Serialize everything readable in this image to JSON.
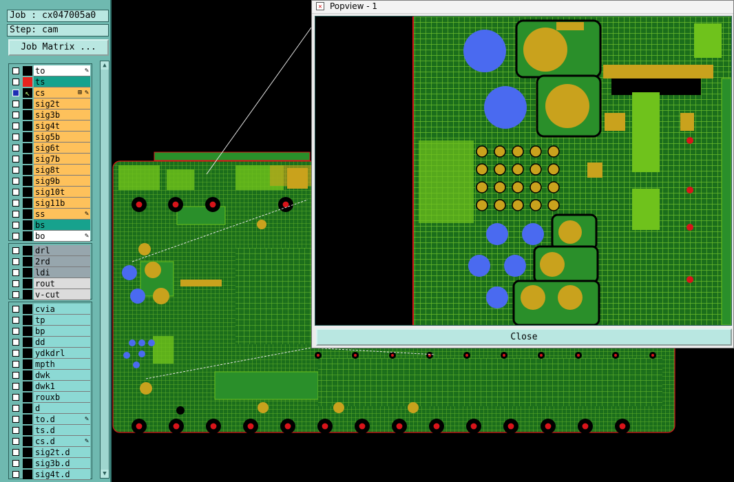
{
  "job_label": "Job : cx047005a0",
  "step_label": "Step: cam",
  "job_matrix_label": "Job Matrix ...",
  "board_layers": [
    {
      "name": "to",
      "color": "#ffffff",
      "mark": "✎"
    },
    {
      "name": "ts",
      "color": "#17a28d",
      "swatch": "red"
    },
    {
      "name": "cs",
      "color": "#fec15b",
      "mark": "✎",
      "mark2": "⊞",
      "checked": true,
      "swatch": "arrow"
    },
    {
      "name": "sig2t",
      "color": "#fec15b"
    },
    {
      "name": "sig3b",
      "color": "#fec15b"
    },
    {
      "name": "sig4t",
      "color": "#fec15b"
    },
    {
      "name": "sig5b",
      "color": "#fec15b"
    },
    {
      "name": "sig6t",
      "color": "#fec15b"
    },
    {
      "name": "sig7b",
      "color": "#fec15b"
    },
    {
      "name": "sig8t",
      "color": "#fec15b"
    },
    {
      "name": "sig9b",
      "color": "#fec15b"
    },
    {
      "name": "sig10t",
      "color": "#fec15b"
    },
    {
      "name": "sig11b",
      "color": "#fec15b"
    },
    {
      "name": "ss",
      "color": "#fec15b",
      "mark": "✎"
    },
    {
      "name": "bs",
      "color": "#17a28d"
    },
    {
      "name": "bo",
      "color": "#ffffff",
      "mark": "✎"
    }
  ],
  "drill_layers": [
    {
      "name": "drl",
      "color": "#97a6ad"
    },
    {
      "name": "2rd",
      "color": "#97a6ad"
    },
    {
      "name": "ldi",
      "color": "#97a6ad"
    },
    {
      "name": "rout",
      "color": "#dcdcdc"
    },
    {
      "name": "v-cut",
      "color": "#dcdcdc"
    }
  ],
  "misc_layers": [
    {
      "name": "cvia",
      "color": "#8cd9d4"
    },
    {
      "name": "tp",
      "color": "#8cd9d4"
    },
    {
      "name": "bp",
      "color": "#8cd9d4"
    },
    {
      "name": "dd",
      "color": "#8cd9d4"
    },
    {
      "name": "ydkdrl",
      "color": "#8cd9d4"
    },
    {
      "name": "mpth",
      "color": "#8cd9d4"
    },
    {
      "name": "dwk",
      "color": "#8cd9d4"
    },
    {
      "name": "dwk1",
      "color": "#8cd9d4"
    },
    {
      "name": "rouxb",
      "color": "#8cd9d4"
    },
    {
      "name": "d",
      "color": "#8cd9d4"
    },
    {
      "name": "to.d",
      "color": "#8cd9d4",
      "mark": "✎"
    },
    {
      "name": "ts.d",
      "color": "#8cd9d4"
    },
    {
      "name": "cs.d",
      "color": "#8cd9d4",
      "mark": "✎"
    },
    {
      "name": "sig2t.d",
      "color": "#8cd9d4"
    },
    {
      "name": "sig3b.d",
      "color": "#8cd9d4"
    },
    {
      "name": "sig4t.d",
      "color": "#8cd9d4"
    }
  ],
  "popview_title": "Popview - 1",
  "close_label": "Close",
  "colors": {
    "board": "#1a7a1a",
    "copper": "#6fc21c",
    "pad": "#c9a21d",
    "via": "#4a6af0",
    "drill": "#d8141a",
    "panel": "#6fb9b0"
  }
}
